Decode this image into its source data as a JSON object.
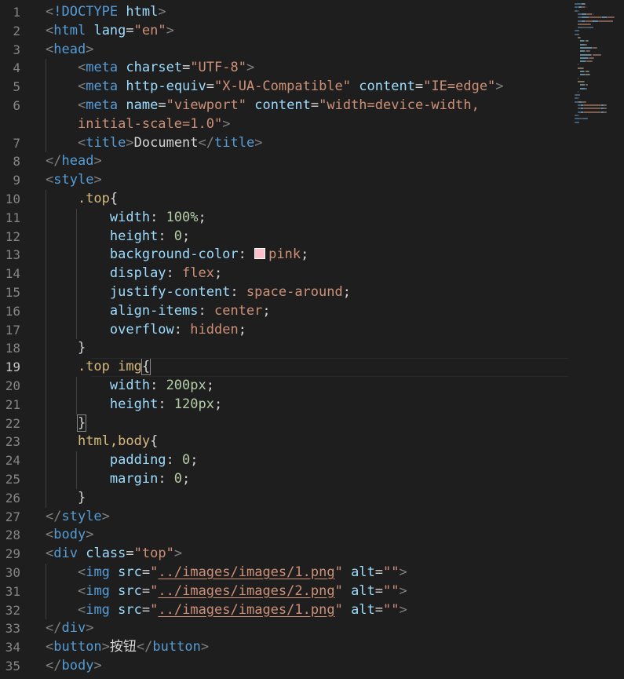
{
  "editor": {
    "colors": {
      "background": "#1e1e1e",
      "tag": "#569cd6",
      "attr": "#9cdcfe",
      "string": "#ce9178",
      "selector": "#d7ba7d",
      "number": "#b5cea8",
      "pink_swatch": "#ffc0cb"
    },
    "active_line": 19,
    "lines": [
      {
        "n": "1",
        "indent": 0,
        "tokens": [
          [
            "punc",
            "<"
          ],
          [
            "tag",
            "!DOCTYPE"
          ],
          [
            "text",
            " "
          ],
          [
            "attr",
            "html"
          ],
          [
            "punc",
            ">"
          ]
        ]
      },
      {
        "n": "2",
        "indent": 0,
        "tokens": [
          [
            "punc",
            "<"
          ],
          [
            "tag",
            "html"
          ],
          [
            "text",
            " "
          ],
          [
            "attr",
            "lang"
          ],
          [
            "text",
            "="
          ],
          [
            "str",
            "\"en\""
          ],
          [
            "punc",
            ">"
          ]
        ]
      },
      {
        "n": "3",
        "indent": 0,
        "tokens": [
          [
            "punc",
            "<"
          ],
          [
            "tag",
            "head"
          ],
          [
            "punc",
            ">"
          ]
        ]
      },
      {
        "n": "4",
        "indent": 1,
        "tokens": [
          [
            "punc",
            "<"
          ],
          [
            "tag",
            "meta"
          ],
          [
            "text",
            " "
          ],
          [
            "attr",
            "charset"
          ],
          [
            "text",
            "="
          ],
          [
            "str",
            "\"UTF-8\""
          ],
          [
            "punc",
            ">"
          ]
        ]
      },
      {
        "n": "5",
        "indent": 1,
        "tokens": [
          [
            "punc",
            "<"
          ],
          [
            "tag",
            "meta"
          ],
          [
            "text",
            " "
          ],
          [
            "attr",
            "http-equiv"
          ],
          [
            "text",
            "="
          ],
          [
            "str",
            "\"X-UA-Compatible\""
          ],
          [
            "text",
            " "
          ],
          [
            "attr",
            "content"
          ],
          [
            "text",
            "="
          ],
          [
            "str",
            "\"IE=edge\""
          ],
          [
            "punc",
            ">"
          ]
        ]
      },
      {
        "n": "6",
        "indent": 1,
        "tokens": [
          [
            "punc",
            "<"
          ],
          [
            "tag",
            "meta"
          ],
          [
            "text",
            " "
          ],
          [
            "attr",
            "name"
          ],
          [
            "text",
            "="
          ],
          [
            "str",
            "\"viewport\""
          ],
          [
            "text",
            " "
          ],
          [
            "attr",
            "content"
          ],
          [
            "text",
            "="
          ],
          [
            "str",
            "\"width=device-width,"
          ]
        ]
      },
      {
        "n": "",
        "indent": 1,
        "tokens": [
          [
            "str",
            "initial-scale=1.0\""
          ],
          [
            "punc",
            ">"
          ]
        ]
      },
      {
        "n": "7",
        "indent": 1,
        "tokens": [
          [
            "punc",
            "<"
          ],
          [
            "tag",
            "title"
          ],
          [
            "punc",
            ">"
          ],
          [
            "text",
            "Document"
          ],
          [
            "punc",
            "</"
          ],
          [
            "tag",
            "title"
          ],
          [
            "punc",
            ">"
          ]
        ]
      },
      {
        "n": "8",
        "indent": 0,
        "tokens": [
          [
            "punc",
            "</"
          ],
          [
            "tag",
            "head"
          ],
          [
            "punc",
            ">"
          ]
        ]
      },
      {
        "n": "9",
        "indent": 0,
        "tokens": [
          [
            "punc",
            "<"
          ],
          [
            "tag",
            "style"
          ],
          [
            "punc",
            ">"
          ]
        ]
      },
      {
        "n": "10",
        "indent": 1,
        "tokens": [
          [
            "sel",
            ".top"
          ],
          [
            "text",
            "{"
          ]
        ]
      },
      {
        "n": "11",
        "indent": 2,
        "tokens": [
          [
            "prop",
            "width"
          ],
          [
            "text",
            ": "
          ],
          [
            "num",
            "100%"
          ],
          [
            "text",
            ";"
          ]
        ]
      },
      {
        "n": "12",
        "indent": 2,
        "tokens": [
          [
            "prop",
            "height"
          ],
          [
            "text",
            ": "
          ],
          [
            "num",
            "0"
          ],
          [
            "text",
            ";"
          ]
        ]
      },
      {
        "n": "13",
        "indent": 2,
        "tokens": [
          [
            "prop",
            "background-color"
          ],
          [
            "text",
            ": "
          ],
          [
            "swatch",
            ""
          ],
          [
            "kw",
            "pink"
          ],
          [
            "text",
            ";"
          ]
        ]
      },
      {
        "n": "14",
        "indent": 2,
        "tokens": [
          [
            "prop",
            "display"
          ],
          [
            "text",
            ": "
          ],
          [
            "kw",
            "flex"
          ],
          [
            "text",
            ";"
          ]
        ]
      },
      {
        "n": "15",
        "indent": 2,
        "tokens": [
          [
            "prop",
            "justify-content"
          ],
          [
            "text",
            ": "
          ],
          [
            "kw",
            "space-around"
          ],
          [
            "text",
            ";"
          ]
        ]
      },
      {
        "n": "16",
        "indent": 2,
        "tokens": [
          [
            "prop",
            "align-items"
          ],
          [
            "text",
            ": "
          ],
          [
            "kw",
            "center"
          ],
          [
            "text",
            ";"
          ]
        ]
      },
      {
        "n": "17",
        "indent": 2,
        "tokens": [
          [
            "prop",
            "overflow"
          ],
          [
            "text",
            ": "
          ],
          [
            "kw",
            "hidden"
          ],
          [
            "text",
            ";"
          ]
        ]
      },
      {
        "n": "18",
        "indent": 1,
        "tokens": [
          [
            "text",
            "}"
          ]
        ]
      },
      {
        "n": "19",
        "indent": 1,
        "tokens": [
          [
            "sel",
            ".top img"
          ],
          [
            "box",
            "{"
          ]
        ]
      },
      {
        "n": "20",
        "indent": 2,
        "tokens": [
          [
            "prop",
            "width"
          ],
          [
            "text",
            ": "
          ],
          [
            "num",
            "200px"
          ],
          [
            "text",
            ";"
          ]
        ]
      },
      {
        "n": "21",
        "indent": 2,
        "tokens": [
          [
            "prop",
            "height"
          ],
          [
            "text",
            ": "
          ],
          [
            "num",
            "120px"
          ],
          [
            "text",
            ";"
          ]
        ]
      },
      {
        "n": "22",
        "indent": 1,
        "tokens": [
          [
            "box",
            "}"
          ]
        ]
      },
      {
        "n": "23",
        "indent": 1,
        "tokens": [
          [
            "sel",
            "html,body"
          ],
          [
            "text",
            "{"
          ]
        ]
      },
      {
        "n": "24",
        "indent": 2,
        "tokens": [
          [
            "prop",
            "padding"
          ],
          [
            "text",
            ": "
          ],
          [
            "num",
            "0"
          ],
          [
            "text",
            ";"
          ]
        ]
      },
      {
        "n": "25",
        "indent": 2,
        "tokens": [
          [
            "prop",
            "margin"
          ],
          [
            "text",
            ": "
          ],
          [
            "num",
            "0"
          ],
          [
            "text",
            ";"
          ]
        ]
      },
      {
        "n": "26",
        "indent": 1,
        "tokens": [
          [
            "text",
            "}"
          ]
        ]
      },
      {
        "n": "27",
        "indent": 0,
        "tokens": [
          [
            "punc",
            "</"
          ],
          [
            "tag",
            "style"
          ],
          [
            "punc",
            ">"
          ]
        ]
      },
      {
        "n": "28",
        "indent": 0,
        "tokens": [
          [
            "punc",
            "<"
          ],
          [
            "tag",
            "body"
          ],
          [
            "punc",
            ">"
          ]
        ]
      },
      {
        "n": "29",
        "indent": 0,
        "tokens": [
          [
            "punc",
            "<"
          ],
          [
            "tag",
            "div"
          ],
          [
            "text",
            " "
          ],
          [
            "attr",
            "class"
          ],
          [
            "text",
            "="
          ],
          [
            "str",
            "\"top\""
          ],
          [
            "punc",
            ">"
          ]
        ]
      },
      {
        "n": "30",
        "indent": 1,
        "tokens": [
          [
            "punc",
            "<"
          ],
          [
            "tag",
            "img"
          ],
          [
            "text",
            " "
          ],
          [
            "attr",
            "src"
          ],
          [
            "text",
            "="
          ],
          [
            "str",
            "\""
          ],
          [
            "link",
            "../images/images/1.png"
          ],
          [
            "str",
            "\""
          ],
          [
            "text",
            " "
          ],
          [
            "attr",
            "alt"
          ],
          [
            "text",
            "="
          ],
          [
            "str",
            "\"\""
          ],
          [
            "punc",
            ">"
          ]
        ]
      },
      {
        "n": "31",
        "indent": 1,
        "tokens": [
          [
            "punc",
            "<"
          ],
          [
            "tag",
            "img"
          ],
          [
            "text",
            " "
          ],
          [
            "attr",
            "src"
          ],
          [
            "text",
            "="
          ],
          [
            "str",
            "\""
          ],
          [
            "link",
            "../images/images/2.png"
          ],
          [
            "str",
            "\""
          ],
          [
            "text",
            " "
          ],
          [
            "attr",
            "alt"
          ],
          [
            "text",
            "="
          ],
          [
            "str",
            "\"\""
          ],
          [
            "punc",
            ">"
          ]
        ]
      },
      {
        "n": "32",
        "indent": 1,
        "tokens": [
          [
            "punc",
            "<"
          ],
          [
            "tag",
            "img"
          ],
          [
            "text",
            " "
          ],
          [
            "attr",
            "src"
          ],
          [
            "text",
            "="
          ],
          [
            "str",
            "\""
          ],
          [
            "link",
            "../images/images/1.png"
          ],
          [
            "str",
            "\""
          ],
          [
            "text",
            " "
          ],
          [
            "attr",
            "alt"
          ],
          [
            "text",
            "="
          ],
          [
            "str",
            "\"\""
          ],
          [
            "punc",
            ">"
          ]
        ]
      },
      {
        "n": "33",
        "indent": 0,
        "tokens": [
          [
            "punc",
            "</"
          ],
          [
            "tag",
            "div"
          ],
          [
            "punc",
            ">"
          ]
        ]
      },
      {
        "n": "34",
        "indent": 0,
        "tokens": [
          [
            "punc",
            "<"
          ],
          [
            "tag",
            "button"
          ],
          [
            "punc",
            ">"
          ],
          [
            "text",
            "按钮"
          ],
          [
            "punc",
            "</"
          ],
          [
            "tag",
            "button"
          ],
          [
            "punc",
            ">"
          ]
        ]
      },
      {
        "n": "35",
        "indent": 0,
        "tokens": [
          [
            "punc",
            "</"
          ],
          [
            "tag",
            "body"
          ],
          [
            "punc",
            ">"
          ]
        ]
      }
    ]
  }
}
